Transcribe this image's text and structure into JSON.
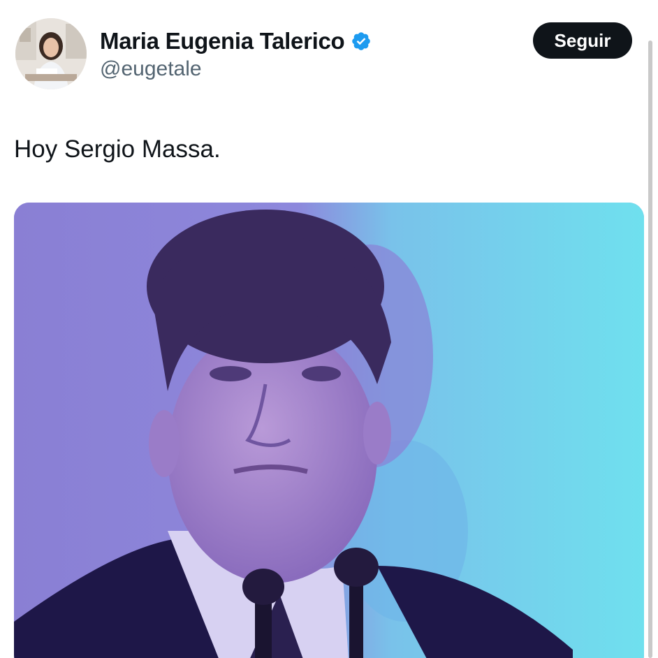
{
  "author": {
    "display_name": "Maria Eugenia Talerico",
    "handle": "@eugetale",
    "verified": true,
    "avatar_icon": "profile-photo"
  },
  "follow_button": {
    "label": "Seguir"
  },
  "tweet": {
    "text": "Hoy Sergio Massa."
  },
  "media": {
    "kind": "photo"
  },
  "colors": {
    "verified_badge": "#1d9bf0",
    "follow_bg": "#0f1419",
    "handle_text": "#536471"
  }
}
